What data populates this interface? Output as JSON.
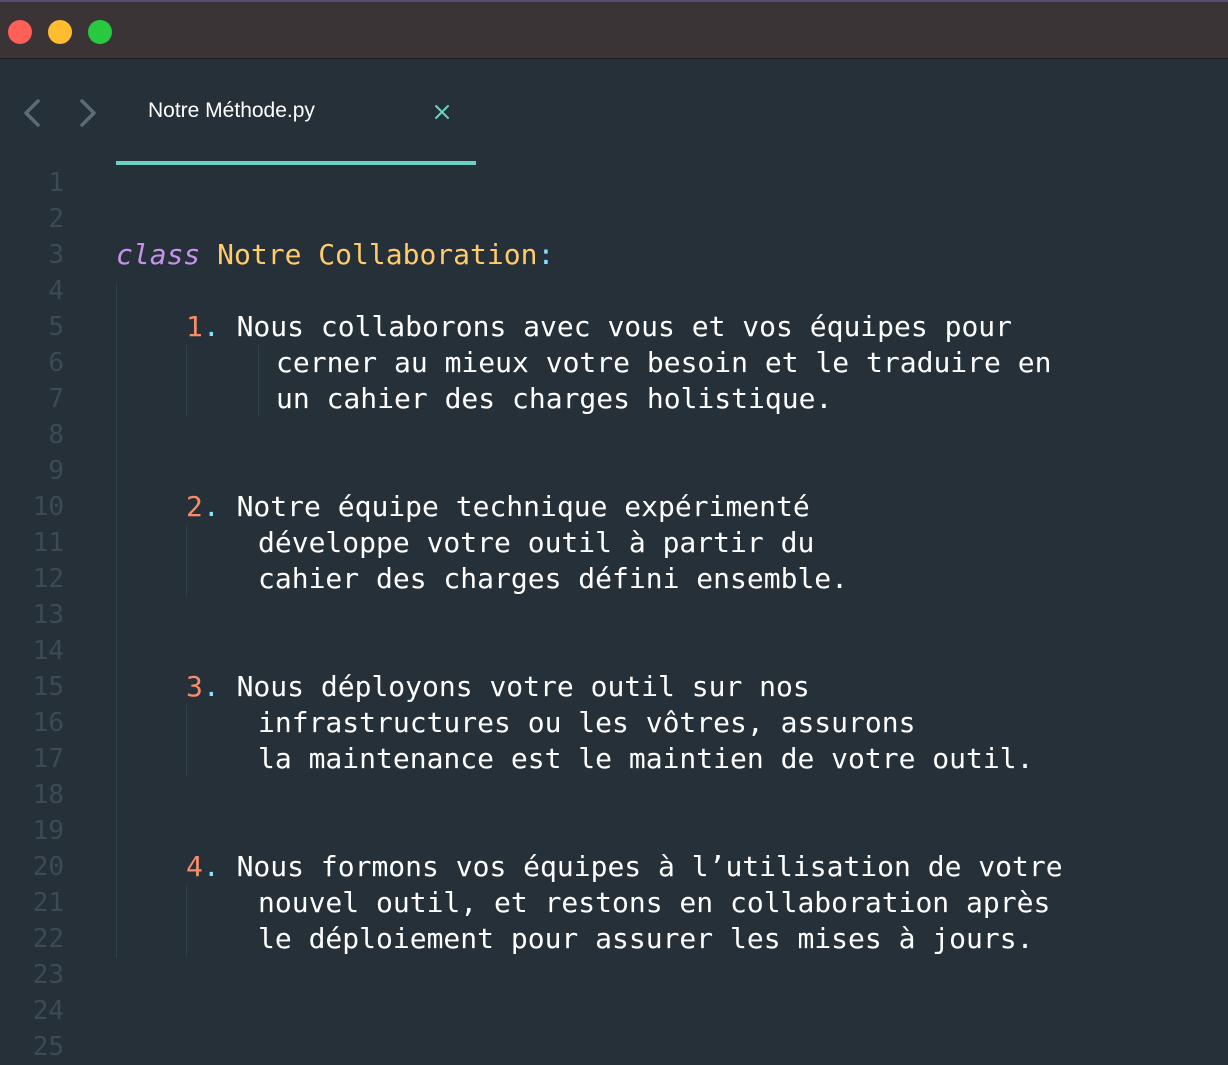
{
  "window": {
    "buttons": [
      "close",
      "minimize",
      "zoom"
    ]
  },
  "nav": {
    "back_icon": "chevron-left-icon",
    "forward_icon": "chevron-right-icon"
  },
  "tab": {
    "title": "Notre Méthode.py",
    "close_icon": "close-icon"
  },
  "colors": {
    "background": "#253038",
    "accent": "#6ad2c2",
    "keyword": "#c792ea",
    "class_name": "#ffcb6b",
    "punctuation": "#89ddff",
    "number": "#f78c6c",
    "line_number": "#3d4a54"
  },
  "gutter": {
    "line_numbers": [
      "1",
      "2",
      "3",
      "4",
      "5",
      "6",
      "7",
      "8",
      "9",
      "10",
      "11",
      "12",
      "13",
      "14",
      "15",
      "16",
      "17",
      "18",
      "19",
      "20",
      "21",
      "22",
      "23",
      "24",
      "25"
    ]
  },
  "code": {
    "keyword": "class",
    "class_name": "Notre Collaboration",
    "colon": ":",
    "items": [
      {
        "number": "1",
        "dot": ".",
        "lines": [
          "Nous collaborons avec vous et vos équipes pour",
          "cerner au mieux votre besoin et le traduire en",
          "un cahier des charges holistique."
        ]
      },
      {
        "number": "2",
        "dot": ".",
        "lines": [
          "Notre équipe technique expérimenté",
          "développe votre outil à partir du",
          "cahier des charges défini ensemble."
        ]
      },
      {
        "number": "3",
        "dot": ".",
        "lines": [
          "Nous déployons votre outil sur nos",
          "infrastructures ou les vôtres, assurons",
          "la maintenance est le maintien de votre outil."
        ]
      },
      {
        "number": "4",
        "dot": ".",
        "lines": [
          "Nous formons vos équipes à l’utilisation de votre",
          "nouvel outil, et restons en collaboration après",
          "le déploiement pour assurer les mises à jours."
        ]
      }
    ]
  }
}
